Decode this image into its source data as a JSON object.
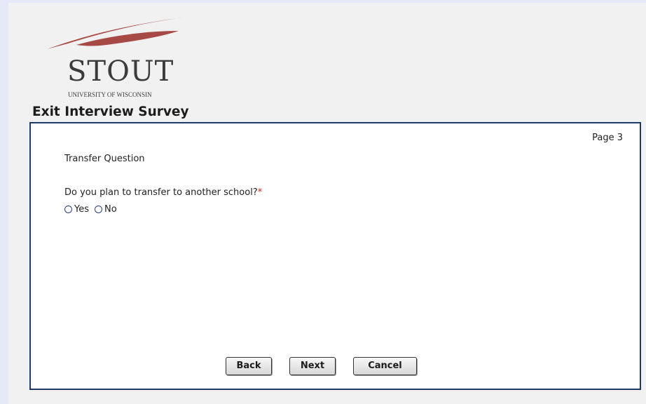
{
  "logo": {
    "wordmark": "STOUT",
    "subtitle": "UNIVERSITY OF WISCONSIN",
    "color": "#a74a45"
  },
  "survey": {
    "title": "Exit Interview Survey"
  },
  "panel": {
    "page_label": "Page 3",
    "section_title": "Transfer Question",
    "question": "Do you plan to transfer to another school?",
    "required_marker": "*",
    "options": [
      "Yes",
      "No"
    ],
    "selected": null
  },
  "buttons": {
    "back": "Back",
    "next": "Next",
    "cancel": "Cancel"
  },
  "colors": {
    "frame_border": "#1e3a66",
    "required": "#d21b1b",
    "background": "#f1f1f1",
    "outer_background": "#e6e9f7"
  }
}
